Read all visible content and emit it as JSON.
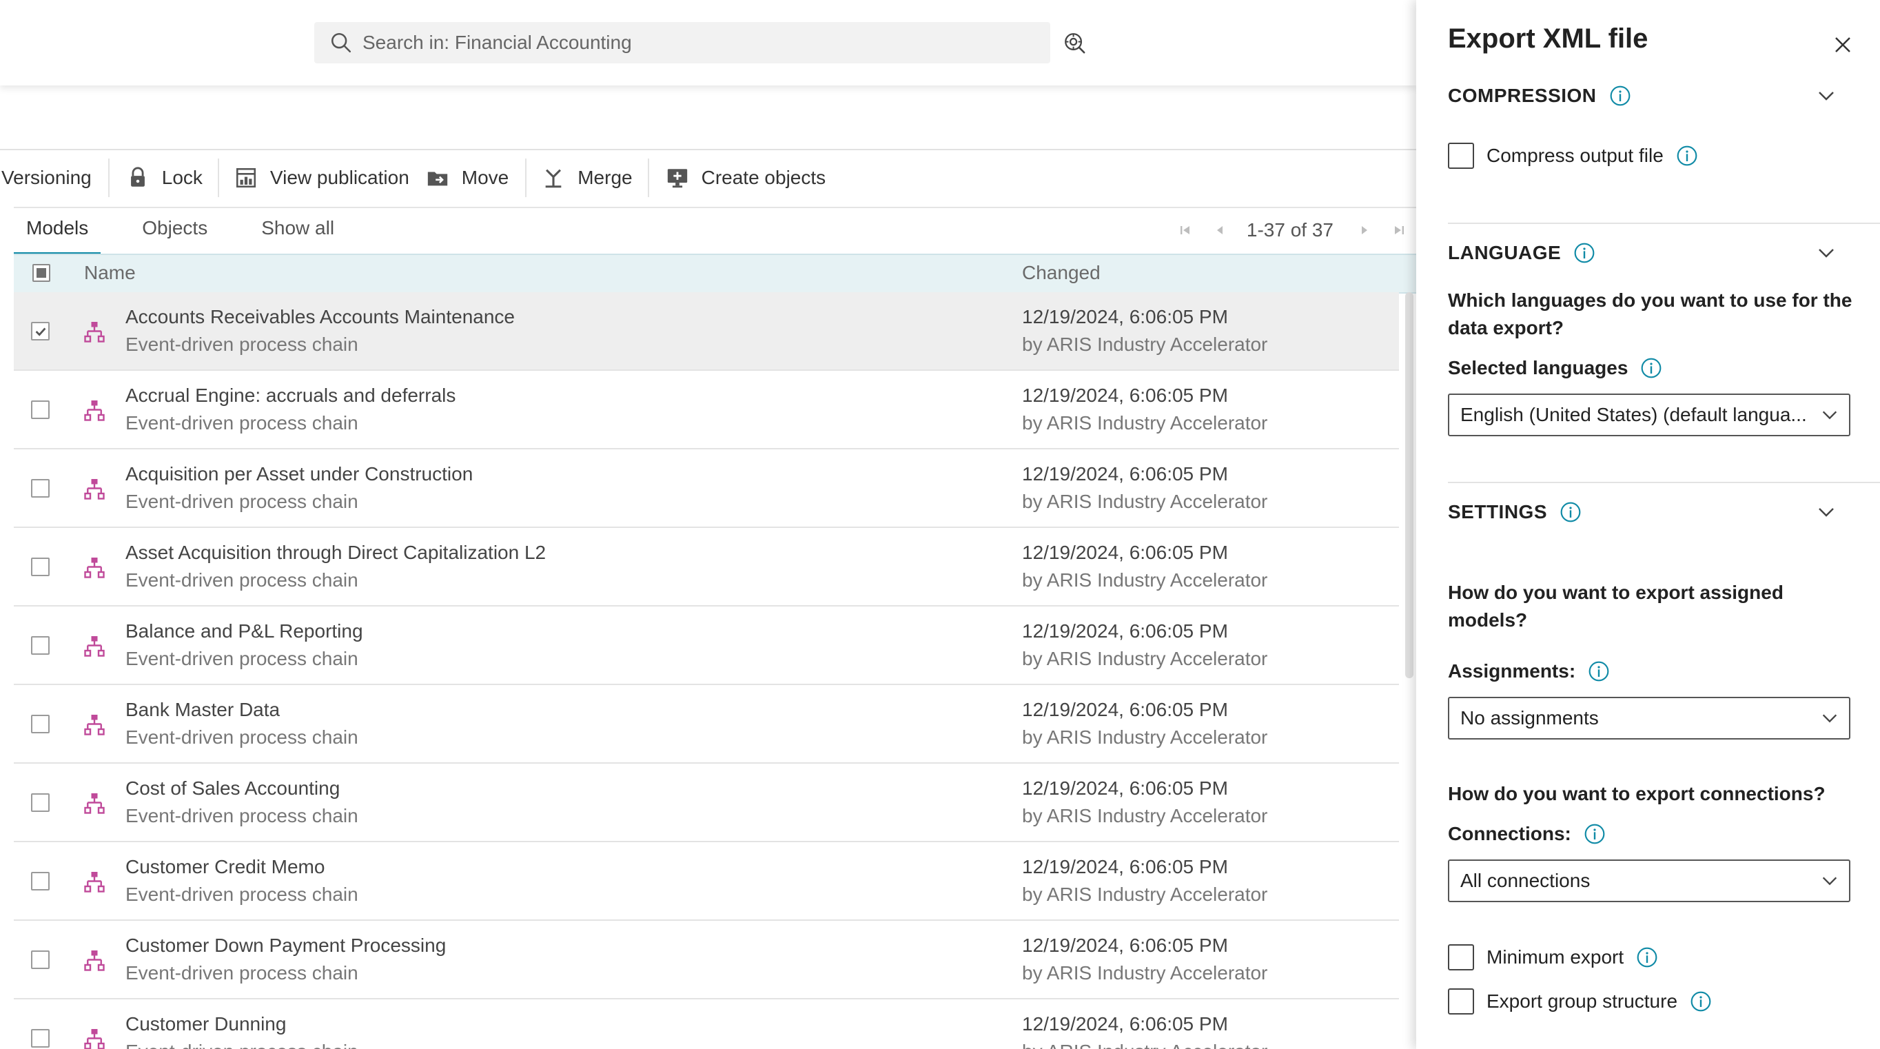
{
  "search": {
    "placeholder": "Search in: Financial Accounting"
  },
  "toolbar": {
    "versioning": "Versioning",
    "lock": "Lock",
    "view_publication": "View publication",
    "move": "Move",
    "merge": "Merge",
    "create_objects": "Create objects"
  },
  "tabs": [
    "Models",
    "Objects",
    "Show all"
  ],
  "pager": {
    "text": "1-37 of 37"
  },
  "columns": {
    "name": "Name",
    "changed": "Changed"
  },
  "rows": [
    {
      "name": "Accounts Receivables Accounts Maintenance",
      "type": "Event-driven process chain",
      "date": "12/19/2024, 6:06:05 PM",
      "user": "by ARIS Industry Accelerator",
      "checked": true
    },
    {
      "name": "Accrual Engine: accruals and deferrals",
      "type": "Event-driven process chain",
      "date": "12/19/2024, 6:06:05 PM",
      "user": "by ARIS Industry Accelerator",
      "checked": false
    },
    {
      "name": "Acquisition per Asset under Construction",
      "type": "Event-driven process chain",
      "date": "12/19/2024, 6:06:05 PM",
      "user": "by ARIS Industry Accelerator",
      "checked": false
    },
    {
      "name": "Asset Acquisition through Direct Capitalization L2",
      "type": "Event-driven process chain",
      "date": "12/19/2024, 6:06:05 PM",
      "user": "by ARIS Industry Accelerator",
      "checked": false
    },
    {
      "name": "Balance and P&L Reporting",
      "type": "Event-driven process chain",
      "date": "12/19/2024, 6:06:05 PM",
      "user": "by ARIS Industry Accelerator",
      "checked": false
    },
    {
      "name": "Bank Master Data",
      "type": "Event-driven process chain",
      "date": "12/19/2024, 6:06:05 PM",
      "user": "by ARIS Industry Accelerator",
      "checked": false
    },
    {
      "name": "Cost of Sales Accounting",
      "type": "Event-driven process chain",
      "date": "12/19/2024, 6:06:05 PM",
      "user": "by ARIS Industry Accelerator",
      "checked": false
    },
    {
      "name": "Customer Credit Memo",
      "type": "Event-driven process chain",
      "date": "12/19/2024, 6:06:05 PM",
      "user": "by ARIS Industry Accelerator",
      "checked": false
    },
    {
      "name": "Customer Down Payment Processing",
      "type": "Event-driven process chain",
      "date": "12/19/2024, 6:06:05 PM",
      "user": "by ARIS Industry Accelerator",
      "checked": false
    },
    {
      "name": "Customer Dunning",
      "type": "Event-driven process chain",
      "date": "12/19/2024, 6:06:05 PM",
      "user": "by ARIS Industry Accelerator",
      "checked": false
    }
  ],
  "panel": {
    "title": "Export XML file",
    "compression": {
      "heading": "COMPRESSION",
      "compress_label": "Compress output file"
    },
    "language": {
      "heading": "LANGUAGE",
      "question": "Which languages do you want to use for the data export?",
      "selected_label": "Selected languages",
      "selected_value": "English (United States) (default langua..."
    },
    "settings": {
      "heading": "SETTINGS",
      "assign_question": "How do you want to export assigned models?",
      "assign_label": "Assignments:",
      "assign_value": "No assignments",
      "conn_question": "How do you want to export connections?",
      "conn_label": "Connections:",
      "conn_value": "All connections",
      "minimum_export": "Minimum export",
      "export_group": "Export group structure"
    }
  },
  "colors": {
    "accent": "#0f8aa6",
    "model_icon": "#c04a9a",
    "header_bg": "#e6f2f4"
  },
  "icons": {
    "search": "search-icon",
    "advanced_search": "advanced-search-icon",
    "lock": "lock-icon",
    "view_publication": "publication-icon",
    "move": "move-folder-icon",
    "merge": "merge-icon",
    "create_objects": "create-objects-icon",
    "model": "epc-model-icon",
    "info": "info-icon",
    "close": "close-icon",
    "chevron": "chevron-down-icon"
  }
}
